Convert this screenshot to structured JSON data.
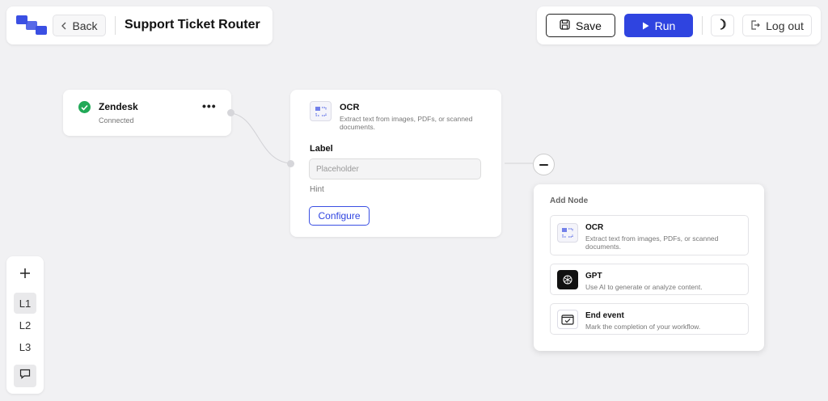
{
  "header": {
    "back_label": "Back",
    "title": "Support Ticket Router"
  },
  "toolbar": {
    "save_label": "Save",
    "run_label": "Run",
    "logout_label": "Log out"
  },
  "nodes": {
    "zendesk": {
      "title": "Zendesk",
      "status": "Connected",
      "menu": "•••"
    },
    "ocr": {
      "title": "OCR",
      "description": "Extract text from images, PDFs, or scanned documents.",
      "label_field": {
        "label": "Label",
        "placeholder": "Placeholder"
      },
      "hint": "Hint",
      "configure_label": "Configure"
    }
  },
  "add_node": {
    "title": "Add Node",
    "options": [
      {
        "title": "OCR",
        "description": "Extract text from images, PDFs, or scanned documents.",
        "icon": "ocr-icon"
      },
      {
        "title": "GPT",
        "description": "Use AI to generate or analyze content.",
        "icon": "gpt-icon"
      },
      {
        "title": "End event",
        "description": "Mark the completion of your workflow.",
        "icon": "end-event-icon"
      }
    ]
  },
  "left_toolbar": {
    "levels": [
      "L1",
      "L2",
      "L3"
    ],
    "active_level": "L1"
  },
  "colors": {
    "accent": "#2f44e0",
    "success": "#21a957",
    "background": "#f1f1f3"
  }
}
